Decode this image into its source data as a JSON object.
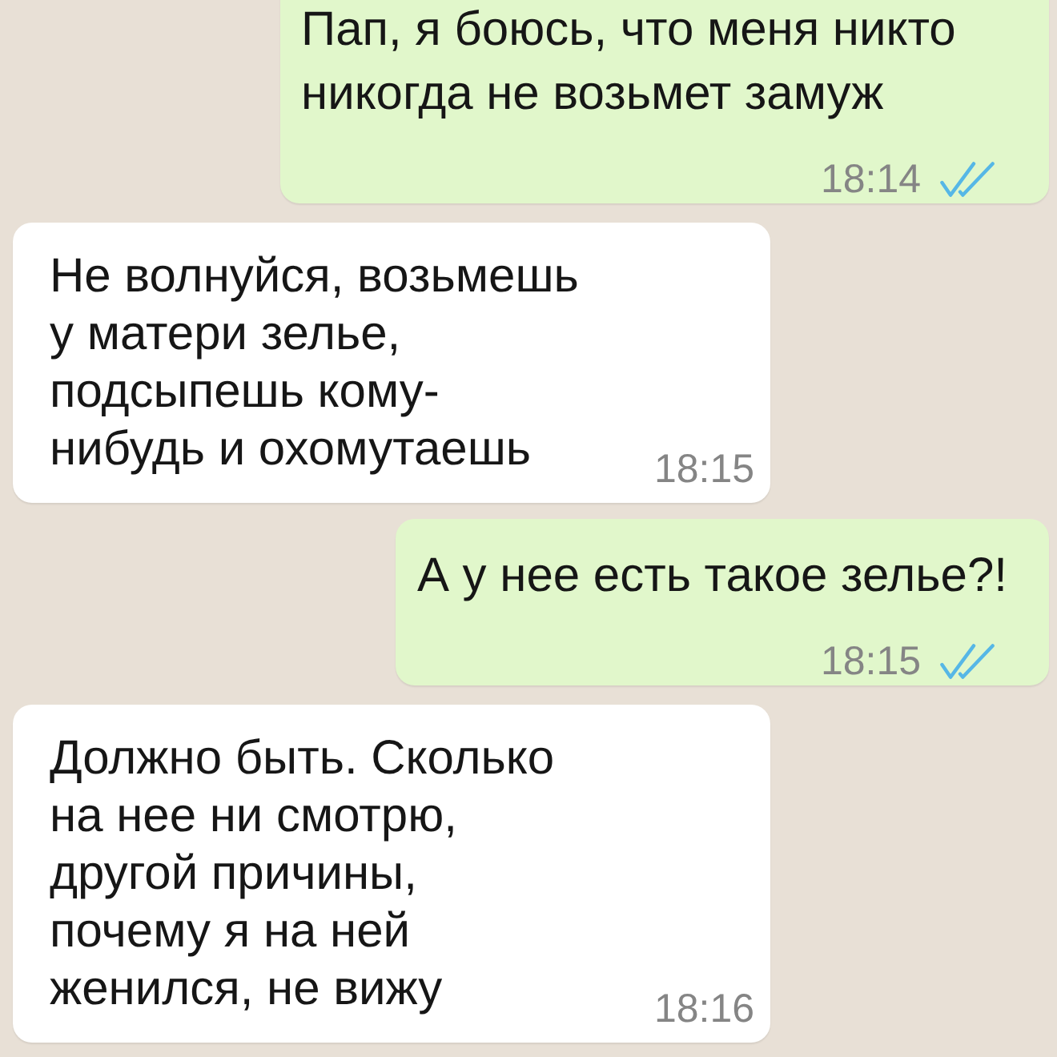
{
  "messages": [
    {
      "kind": "outgoing",
      "text": "Пап, я боюсь, что меня никто никогда не возьмет замуж",
      "time": "18:14",
      "read": true
    },
    {
      "kind": "incoming",
      "text": "Не волнуйся, возьмешь у матери зелье, подсыпешь кому-нибудь и охомутаешь",
      "time": "18:15"
    },
    {
      "kind": "outgoing",
      "text": "А у нее есть такое зелье?!",
      "time": "18:15",
      "read": true
    },
    {
      "kind": "incoming",
      "text": "Должно быть. Сколько на нее ни смотрю, другой причины, почему я на ней женился, не вижу",
      "time": "18:16"
    }
  ]
}
